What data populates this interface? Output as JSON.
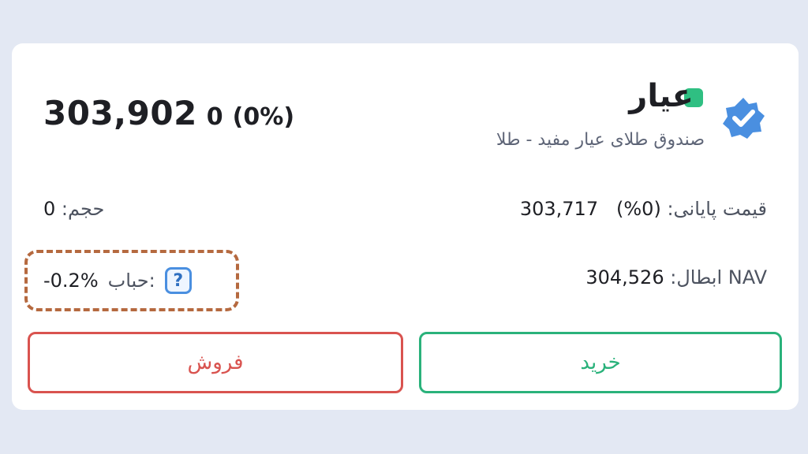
{
  "header": {
    "symbol": "عیار",
    "fund_name": "صندوق طلای عیار مفید - طلا",
    "last_price": "303,902",
    "change_abs": "0",
    "change_pct": "(0%)",
    "status_color": "#2fbf82",
    "verified_icon": "verified-badge-icon"
  },
  "info": {
    "closing_price_label": "قیمت پایانی:",
    "closing_price_value": "303,717",
    "closing_price_pct": "(0%)",
    "volume_label": "حجم:",
    "volume_value": "0",
    "nav_label": "NAV ابطال:",
    "nav_value": "304,526",
    "bubble_label": "حباب:",
    "bubble_value": "-0.2%",
    "help_icon": "?"
  },
  "actions": {
    "buy_label": "خرید",
    "sell_label": "فروش",
    "buy_color": "#2ab27b",
    "sell_color": "#d9534f"
  }
}
